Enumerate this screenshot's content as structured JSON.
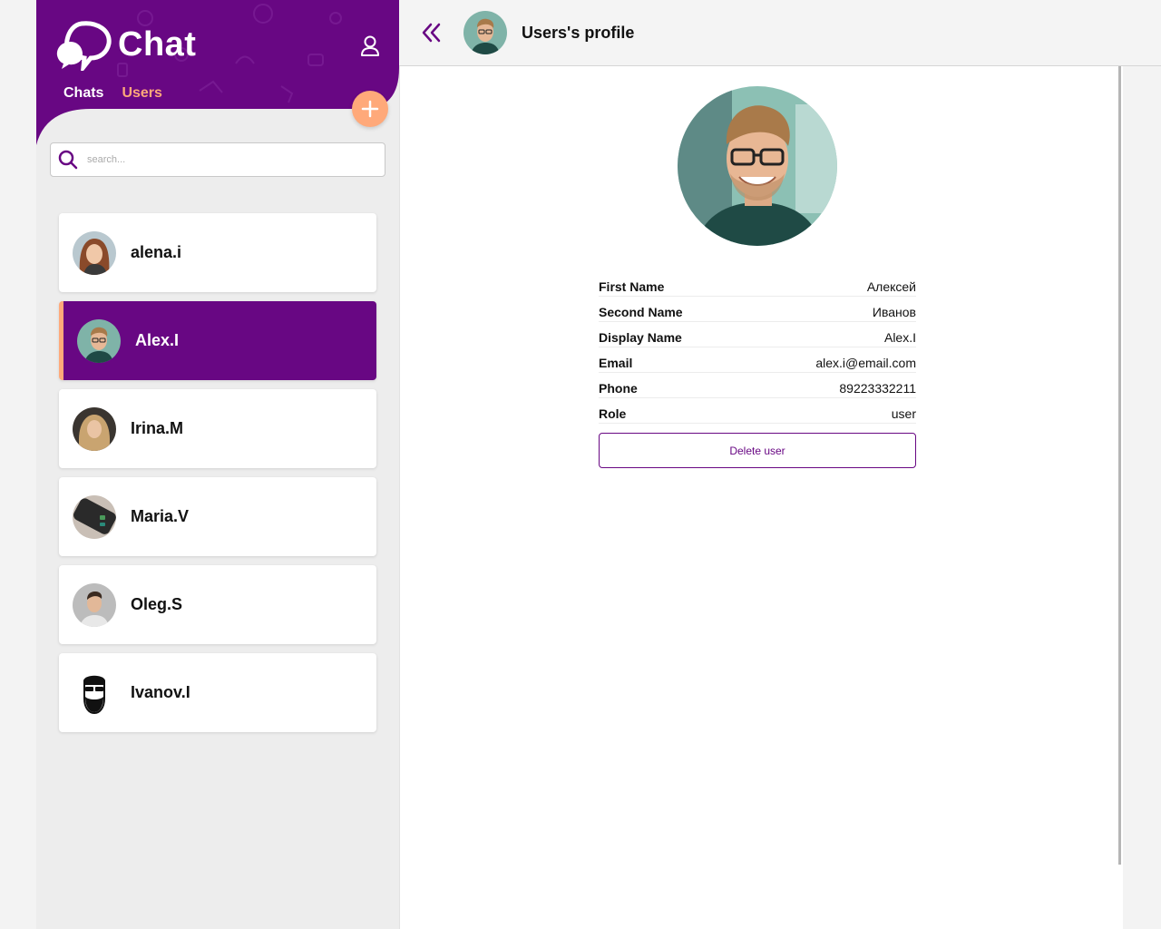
{
  "app": {
    "logo_text": "Chat"
  },
  "colors": {
    "brand": "#680783",
    "accent": "#ffa97a"
  },
  "nav": {
    "chats_label": "Chats",
    "users_label": "Users"
  },
  "search": {
    "placeholder": "search..."
  },
  "users": [
    {
      "name": "alena.i",
      "active": false
    },
    {
      "name": "Alex.I",
      "active": true
    },
    {
      "name": "Irina.M",
      "active": false
    },
    {
      "name": "Maria.V",
      "active": false
    },
    {
      "name": "Oleg.S",
      "active": false
    },
    {
      "name": "Ivanov.I",
      "active": false
    }
  ],
  "profile": {
    "title": "Users's profile",
    "fields": [
      {
        "label": "First Name",
        "value": "Алексей"
      },
      {
        "label": "Second Name",
        "value": "Иванов"
      },
      {
        "label": "Display Name",
        "value": "Alex.I"
      },
      {
        "label": "Email",
        "value": "alex.i@email.com"
      },
      {
        "label": "Phone",
        "value": "89223332211"
      },
      {
        "label": "Role",
        "value": "user"
      }
    ],
    "delete_label": "Delete user"
  }
}
